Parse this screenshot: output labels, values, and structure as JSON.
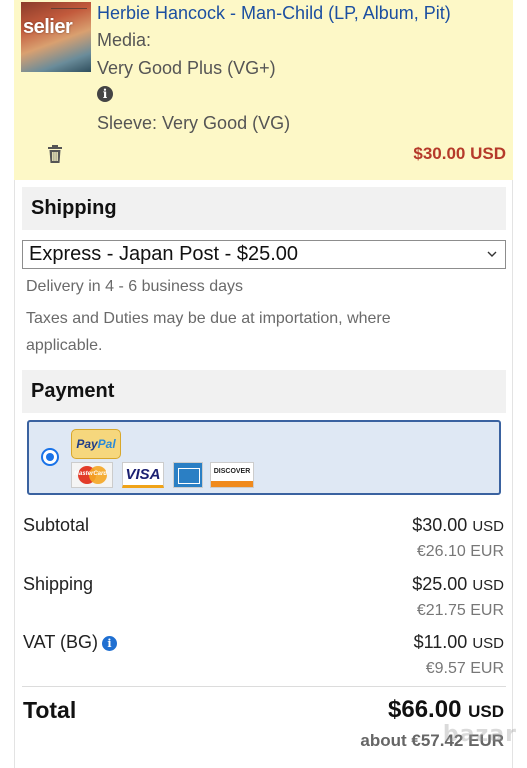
{
  "cart_item": {
    "thumbnail_text": "selier",
    "title": "Herbie Hancock - Man-Child (LP, Album, Pit)",
    "media_label": "Media:",
    "media_value": "Very Good Plus (VG+)",
    "info_icon": "i",
    "sleeve": "Sleeve: Very Good (VG)",
    "price": "$30.00 USD",
    "delete_icon": "trash-icon"
  },
  "shipping": {
    "heading": "Shipping",
    "selected_option": "Express - Japan Post - $25.00",
    "delivery": "Delivery in 4 - 6 business days",
    "taxes_line1": "Taxes and Duties may be due at importation, where",
    "taxes_line2": "applicable."
  },
  "payment": {
    "heading": "Payment",
    "paypal_a": "Pay",
    "paypal_b": "Pal",
    "mastercard": "MasterCard",
    "visa": "VISA",
    "discover": "DISCOVER"
  },
  "summary": {
    "subtotal_label": "Subtotal",
    "subtotal_usd": "$30.00",
    "subtotal_eur": "€26.10 EUR",
    "shipping_label": "Shipping",
    "shipping_usd": "$25.00",
    "shipping_eur": "€21.75 EUR",
    "vat_label": "VAT (BG)",
    "vat_usd": "$11.00",
    "vat_eur": "€9.57 EUR",
    "usd_suffix": "USD",
    "total_label": "Total",
    "total_usd": "$66.00",
    "total_eur": "about €57.42 EUR"
  },
  "watermark": "bazar",
  "colors": {
    "item_bg": "#fdf8c7",
    "link_blue": "#1c4fa1",
    "price_red": "#b53a2a",
    "payment_border": "#3a62a0",
    "radio_blue": "#1a73e8"
  }
}
